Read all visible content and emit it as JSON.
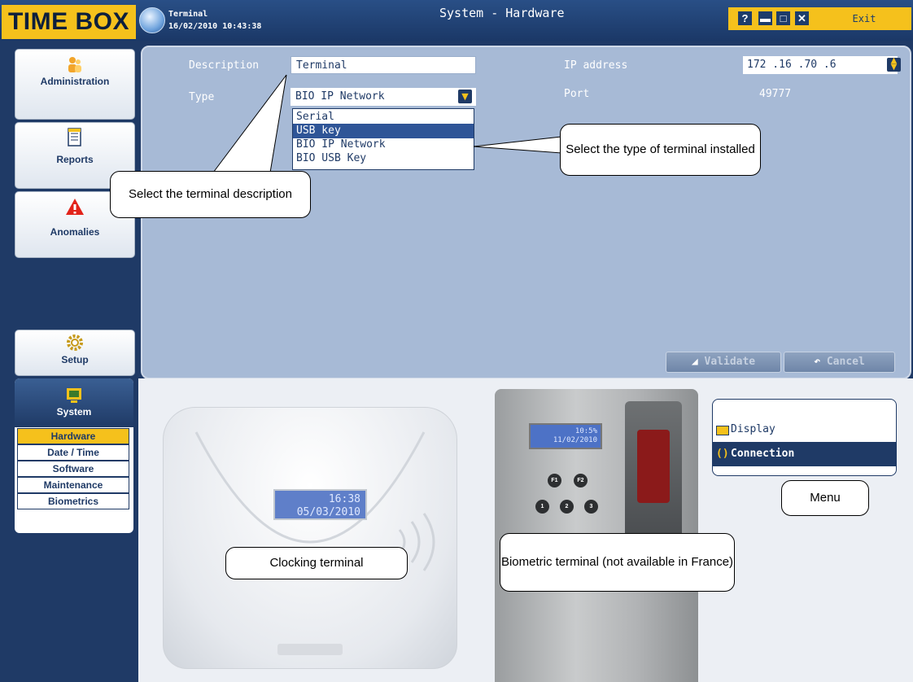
{
  "titlebar": {
    "logo": "TIME BOX",
    "terminal_name": "Terminal",
    "terminal_datetime": "16/02/2010 10:43:38",
    "window_title": "System - Hardware",
    "help_glyph": "?",
    "minimize_glyph": "▬",
    "maximize_glyph": "□",
    "close_glyph": "✕",
    "exit_label": "Exit"
  },
  "sidebar": {
    "administration": "Administration",
    "reports": "Reports",
    "anomalies": "Anomalies",
    "setup": "Setup",
    "system": "System",
    "submenu": [
      "Hardware",
      "Date / Time",
      "Software",
      "Maintenance",
      "Biometrics"
    ],
    "selected": "Hardware"
  },
  "form": {
    "description_label": "Description",
    "description_value": "Terminal",
    "type_label": "Type",
    "type_value": "BIO IP Network",
    "type_options": [
      "Serial",
      "USB key",
      "BIO IP Network",
      "BIO USB Key"
    ],
    "type_highlighted": "USB key",
    "ip_label": "IP address",
    "ip_value": "172 .16  .70  .6",
    "port_label": "Port",
    "port_value": "49777",
    "validate_label": "Validate",
    "cancel_label": "Cancel"
  },
  "devices": {
    "clock_lcd_time": "16:38",
    "clock_lcd_date": "05/03/2010",
    "bio_lcd_time": "10:5%",
    "bio_lcd_date": "11/02/2010",
    "bio_keys": [
      "F1",
      "F2",
      "1",
      "2",
      "3"
    ]
  },
  "menu": {
    "display_label": "Display",
    "connection_label": "Connection"
  },
  "callouts": {
    "terminal_description": "Select the terminal description",
    "terminal_type": "Select the type of terminal installed",
    "clocking_terminal": "Clocking terminal",
    "biometric_terminal": "Biometric terminal (not available in France)",
    "menu": "Menu"
  },
  "colors": {
    "navy": "#1f3a66",
    "accent_yellow": "#f5c11c",
    "panel_blue": "#a7bad6",
    "selection_blue": "#2f5597"
  }
}
